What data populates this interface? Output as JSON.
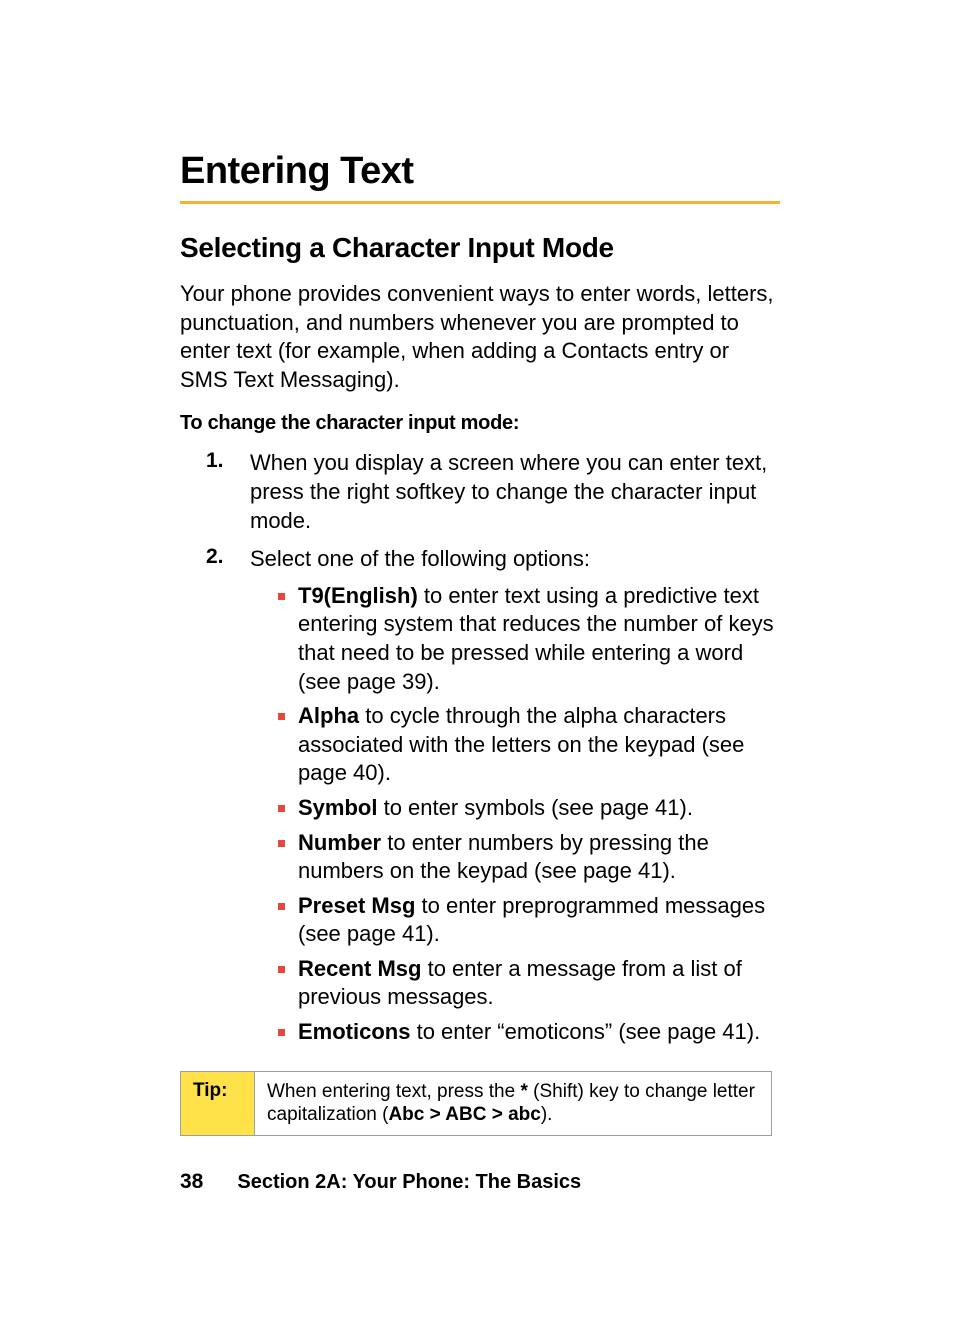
{
  "heading": "Entering Text",
  "subheading": "Selecting a Character Input Mode",
  "intro": "Your phone provides convenient ways to enter words, letters, punctuation, and numbers whenever you are prompted to enter text (for example, when adding a Contacts entry or SMS Text Messaging).",
  "procedure_title": "To change the character input mode:",
  "steps": [
    {
      "num": "1.",
      "text": "When you display a screen where you can enter text, press the right softkey to change the character input mode."
    },
    {
      "num": "2.",
      "text": "Select one of the following options:"
    }
  ],
  "options": [
    {
      "bold": "T9(English)",
      "rest": " to enter text using a predictive text entering system that reduces the number of keys that need to be pressed while entering a word (see page 39)."
    },
    {
      "bold": "Alpha",
      "rest": " to cycle through the alpha characters associated with the letters on the keypad (see page 40)."
    },
    {
      "bold": "Symbol",
      "rest": " to enter symbols (see page 41)."
    },
    {
      "bold": "Number",
      "rest": " to enter numbers by pressing the numbers on the keypad (see page 41)."
    },
    {
      "bold": "Preset Msg",
      "rest": " to enter preprogrammed messages (see page 41)."
    },
    {
      "bold": "Recent Msg",
      "rest": " to enter a message from a list of previous messages."
    },
    {
      "bold": "Emoticons",
      "rest": " to enter “emoticons” (see page 41)."
    }
  ],
  "tip": {
    "label": "Tip:",
    "pre": "When entering text, press the ",
    "star": "*",
    "mid": " (Shift) key to change letter capitalization (",
    "caps": "Abc > ABC > abc",
    "post": ")."
  },
  "footer": {
    "page": "38",
    "section": "Section 2A: Your Phone: The Basics"
  }
}
